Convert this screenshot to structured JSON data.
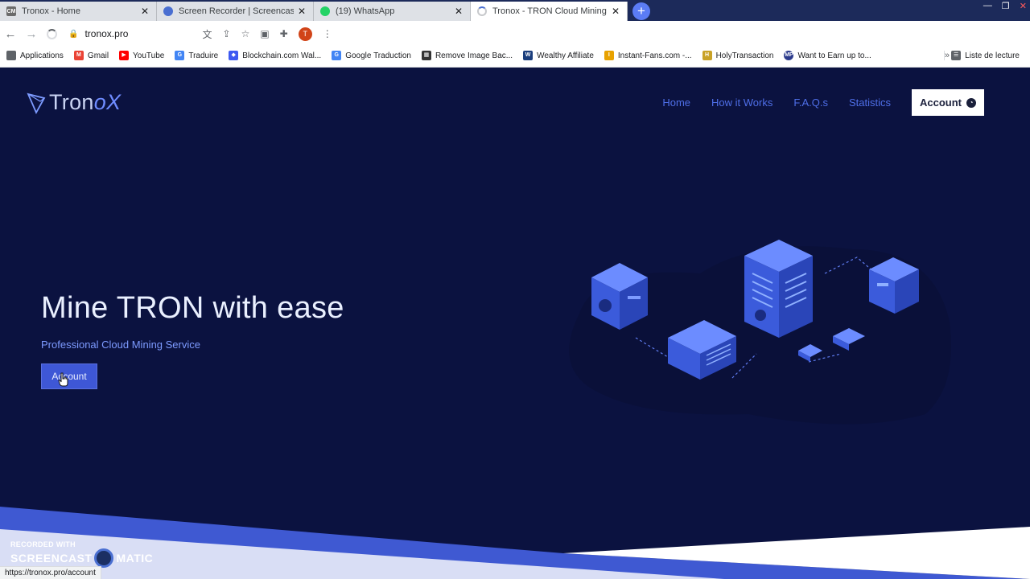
{
  "tabs": [
    {
      "title": "Tronox - Home",
      "icon": "tronox-favicon",
      "active": false
    },
    {
      "title": "Screen Recorder | Screencast-O-M",
      "icon": "screencast-favicon",
      "active": false
    },
    {
      "title": "(19) WhatsApp",
      "icon": "whatsapp-favicon",
      "active": false
    },
    {
      "title": "Tronox - TRON Cloud Mining",
      "icon": "loading-spinner",
      "active": true
    }
  ],
  "address_bar": {
    "url": "tronox.pro"
  },
  "bookmarks": [
    {
      "label": "Applications",
      "icon": "apps-icon"
    },
    {
      "label": "Gmail",
      "icon": "gmail-icon"
    },
    {
      "label": "YouTube",
      "icon": "youtube-icon"
    },
    {
      "label": "Traduire",
      "icon": "translate-icon"
    },
    {
      "label": "Blockchain.com Wal...",
      "icon": "blockchain-icon"
    },
    {
      "label": "Google Traduction",
      "icon": "translate-icon"
    },
    {
      "label": "Remove Image Bac...",
      "icon": "removebg-icon"
    },
    {
      "label": "Wealthy Affiliate",
      "icon": "wa-icon"
    },
    {
      "label": "Instant-Fans.com -...",
      "icon": "instantfans-icon"
    },
    {
      "label": "HolyTransaction",
      "icon": "holy-icon"
    },
    {
      "label": "Want to Earn up to...",
      "icon": "mp-icon"
    }
  ],
  "reading_list": "Liste de lecture",
  "site": {
    "logo_text_a": "Tron",
    "logo_text_b": "oX",
    "nav": [
      "Home",
      "How it Works",
      "F.A.Q.s",
      "Statistics"
    ],
    "account_button": "Account",
    "hero_title": "Mine TRON with ease",
    "hero_subtitle": "Professional Cloud Mining Service",
    "hero_button": "Account"
  },
  "watermark": {
    "line1": "RECORDED WITH",
    "line2a": "SCREENCAST",
    "line2b": "MATIC"
  },
  "status_url": "https://tronox.pro/account",
  "colors": {
    "page_bg": "#0b1240",
    "accent": "#3e57d6",
    "nav_link": "#4f6fe8",
    "subtitle": "#7d9bff"
  }
}
